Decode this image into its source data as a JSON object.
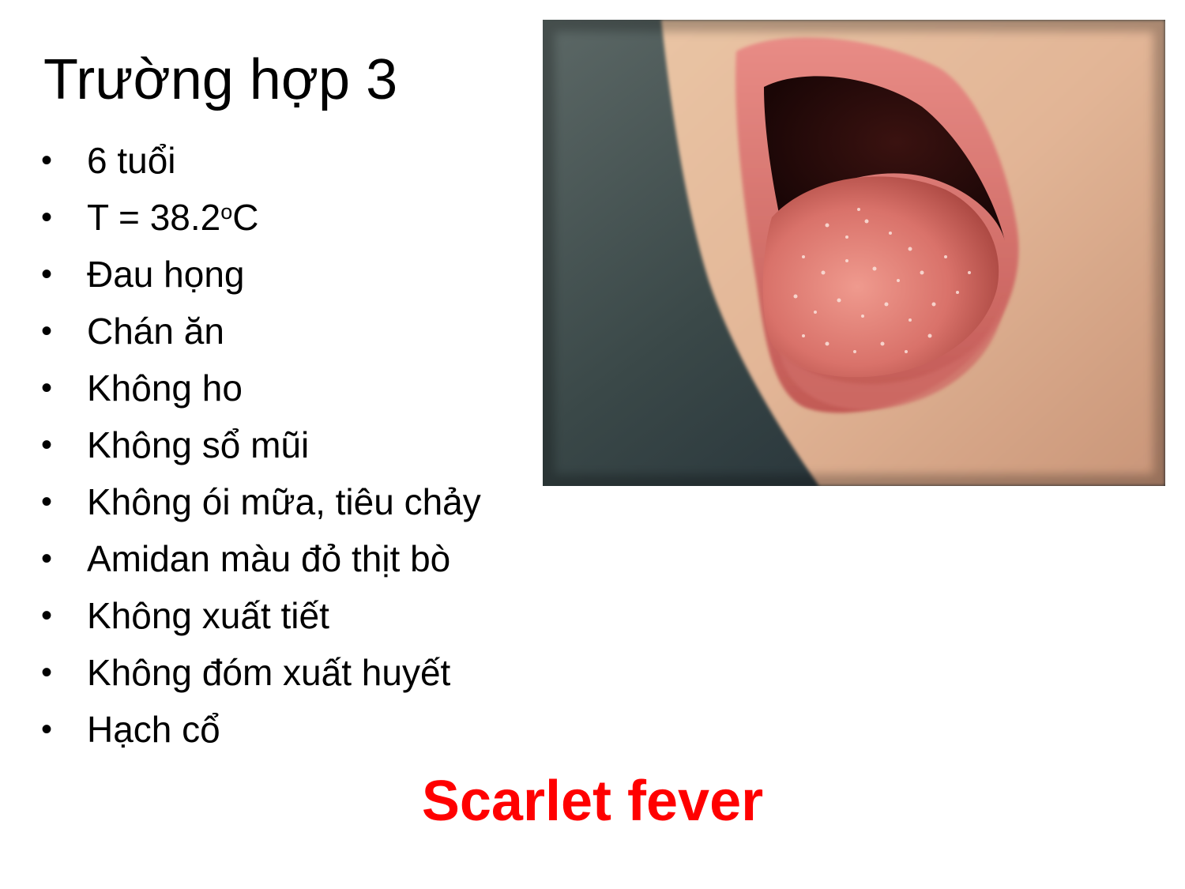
{
  "slide": {
    "title": "Trường hợp 3",
    "bullets": [
      {
        "text": "6 tuổi"
      },
      {
        "text": "T = 38.2",
        "superscript": "o",
        "suffix": "C"
      },
      {
        "text": "Đau họng"
      },
      {
        "text": "Chán ăn"
      },
      {
        "text": "Không ho"
      },
      {
        "text": "Không sổ mũi"
      },
      {
        "text": "Không ói mữa, tiêu chảy"
      },
      {
        "text": "Amidan màu đỏ thịt bò"
      },
      {
        "text": "Không xuất tiết"
      },
      {
        "text": "Không đóm xuất huyết"
      },
      {
        "text": "Hạch cổ"
      }
    ],
    "bullet_marker": "•",
    "conclusion": "Scarlet fever"
  },
  "photo": {
    "subject": "strawberry-tongue-photo"
  },
  "colors": {
    "text": "#000000",
    "conclusion": "#ff0000",
    "background": "#ffffff"
  }
}
